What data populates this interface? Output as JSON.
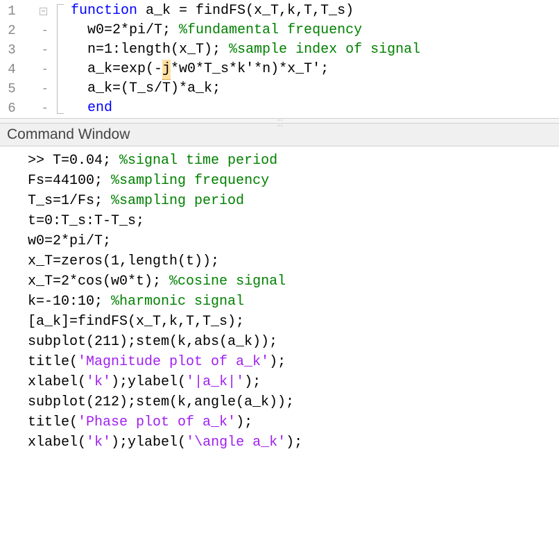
{
  "editor": {
    "gutter": [
      "1",
      "2",
      "3",
      "4",
      "5",
      "6"
    ],
    "fold": [
      "",
      "-",
      "-",
      "-",
      "-",
      "-"
    ],
    "lines": [
      {
        "pre": "",
        "kw": "function",
        "mid": " a_k = findFS(x_T,k,T,T_s)",
        "cm": ""
      },
      {
        "pre": "  w0=2*pi/T; ",
        "kw": "",
        "mid": "",
        "cm": "%fundamental frequency"
      },
      {
        "pre": "  n=1:length(x_T); ",
        "kw": "",
        "mid": "",
        "cm": "%sample index of signal"
      },
      {
        "pre": "  a_k=exp(-",
        "j": "j",
        "post": "*w0*T_s*k'*n)*x_T';",
        "kw": "",
        "mid": "",
        "cm": ""
      },
      {
        "pre": "  a_k=(T_s/T)*a_k;",
        "kw": "",
        "mid": "",
        "cm": ""
      },
      {
        "pre": "  ",
        "kw": "end",
        "mid": "",
        "cm": ""
      }
    ]
  },
  "panel_title": "Command Window",
  "command": {
    "prompt": ">> ",
    "lines": [
      {
        "seg": [
          {
            "t": "T=0.04; ",
            "c": ""
          },
          {
            "t": "%signal time period",
            "c": "cm"
          }
        ]
      },
      {
        "seg": [
          {
            "t": "Fs=44100; ",
            "c": ""
          },
          {
            "t": "%sampling frequency",
            "c": "cm"
          }
        ]
      },
      {
        "seg": [
          {
            "t": "T_s=1/Fs; ",
            "c": ""
          },
          {
            "t": "%sampling period",
            "c": "cm"
          }
        ]
      },
      {
        "seg": [
          {
            "t": "t=0:T_s:T-T_s;",
            "c": ""
          }
        ]
      },
      {
        "seg": [
          {
            "t": "w0=2*pi/T;",
            "c": ""
          }
        ]
      },
      {
        "seg": [
          {
            "t": "x_T=zeros(1,length(t));",
            "c": ""
          }
        ]
      },
      {
        "seg": [
          {
            "t": "x_T=2*cos(w0*t); ",
            "c": ""
          },
          {
            "t": "%cosine signal",
            "c": "cm"
          }
        ]
      },
      {
        "seg": [
          {
            "t": "k=-10:10; ",
            "c": ""
          },
          {
            "t": "%harmonic signal",
            "c": "cm"
          }
        ]
      },
      {
        "seg": [
          {
            "t": "[a_k]=findFS(x_T,k,T,T_s);",
            "c": ""
          }
        ]
      },
      {
        "seg": [
          {
            "t": "subplot(211);stem(k,abs(a_k));",
            "c": ""
          }
        ]
      },
      {
        "seg": [
          {
            "t": "title(",
            "c": ""
          },
          {
            "t": "'Magnitude plot of a_k'",
            "c": "str"
          },
          {
            "t": ");",
            "c": ""
          }
        ]
      },
      {
        "seg": [
          {
            "t": "xlabel(",
            "c": ""
          },
          {
            "t": "'k'",
            "c": "str"
          },
          {
            "t": ");ylabel(",
            "c": ""
          },
          {
            "t": "'|a_k|'",
            "c": "str"
          },
          {
            "t": ");",
            "c": ""
          }
        ]
      },
      {
        "seg": [
          {
            "t": "subplot(212);stem(k,angle(a_k));",
            "c": ""
          }
        ]
      },
      {
        "seg": [
          {
            "t": "title(",
            "c": ""
          },
          {
            "t": "'Phase plot of a_k'",
            "c": "str"
          },
          {
            "t": ");",
            "c": ""
          }
        ]
      },
      {
        "seg": [
          {
            "t": "xlabel(",
            "c": ""
          },
          {
            "t": "'k'",
            "c": "str"
          },
          {
            "t": ");ylabel(",
            "c": ""
          },
          {
            "t": "'\\angle a_k'",
            "c": "str"
          },
          {
            "t": ");",
            "c": ""
          }
        ]
      }
    ]
  }
}
